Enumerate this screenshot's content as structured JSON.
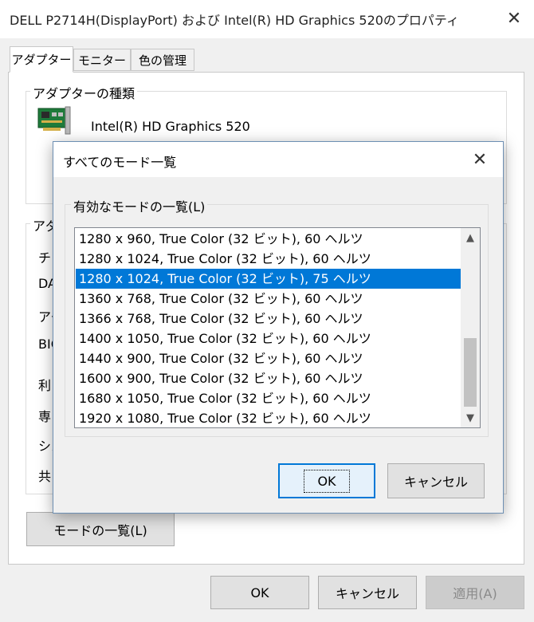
{
  "window": {
    "title": "DELL P2714H(DisplayPort) および Intel(R) HD Graphics 520のプロパティ",
    "close": "✕"
  },
  "tabs": [
    {
      "label": "アダプター",
      "active": true
    },
    {
      "label": "モニター",
      "active": false
    },
    {
      "label": "色の管理",
      "active": false
    }
  ],
  "adapter_type": {
    "group_label": "アダプターの種類",
    "name": "Intel(R) HD Graphics 520"
  },
  "adapter_info": {
    "group_label_partial": "アダ",
    "labels_partial": [
      "チッ",
      "DA",
      "アク",
      "BIO",
      "利",
      "専",
      "シス",
      "共"
    ]
  },
  "list_modes_button": "モードの一覧(L)",
  "footer": {
    "ok": "OK",
    "cancel": "キャンセル",
    "apply": "適用(A)"
  },
  "modal": {
    "title": "すべてのモード一覧",
    "close": "✕",
    "group_label": "有効なモードの一覧(L)",
    "modes": [
      "1280 x 960, True Color (32 ビット), 60 ヘルツ",
      "1280 x 1024, True Color (32 ビット), 60 ヘルツ",
      "1280 x 1024, True Color (32 ビット), 75 ヘルツ",
      "1360 x 768, True Color (32 ビット), 60 ヘルツ",
      "1366 x 768, True Color (32 ビット), 60 ヘルツ",
      "1400 x 1050, True Color (32 ビット), 60 ヘルツ",
      "1440 x 900, True Color (32 ビット), 60 ヘルツ",
      "1600 x 900, True Color (32 ビット), 60 ヘルツ",
      "1680 x 1050, True Color (32 ビット), 60 ヘルツ",
      "1920 x 1080, True Color (32 ビット), 60 ヘルツ"
    ],
    "selected_index": 2,
    "scroll_up": "▲",
    "scroll_down": "▼",
    "ok": "OK",
    "cancel": "キャンセル"
  },
  "colors": {
    "selection": "#0078d7",
    "focus_border": "#0078d7"
  }
}
